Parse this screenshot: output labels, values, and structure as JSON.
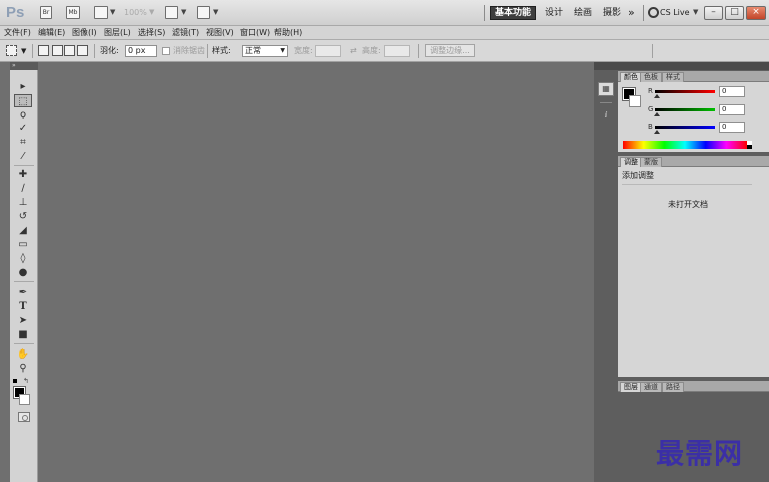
{
  "appbar": {
    "logo": "Ps",
    "zoom": "100%",
    "workspaces": [
      "基本功能",
      "设计",
      "绘画",
      "摄影"
    ],
    "more": "»",
    "cslive": "CS Live",
    "win_min": "–",
    "win_max": "□",
    "win_close": "×",
    "icons": [
      "bridge-icon",
      "minibridge-icon",
      "screen-mode-icon",
      "arrange-icon",
      "extras-icon"
    ]
  },
  "menu": [
    "文件(F)",
    "编辑(E)",
    "图像(I)",
    "图层(L)",
    "选择(S)",
    "滤镜(T)",
    "视图(V)",
    "窗口(W)",
    "帮助(H)"
  ],
  "options": {
    "feather_label": "羽化:",
    "feather_value": "0 px",
    "antialias_label": "消除锯齿",
    "style_label": "样式:",
    "style_value": "正常",
    "width_label": "宽度:",
    "height_label": "高度:",
    "refine_label": "调整边缘..."
  },
  "tools": [
    "move",
    "marquee",
    "lasso",
    "quick-select",
    "crop",
    "eyedropper",
    "healing",
    "brush",
    "stamp",
    "history-brush",
    "eraser",
    "gradient",
    "blur",
    "dodge",
    "pen",
    "type",
    "path-select",
    "shape",
    "hand",
    "zoom"
  ],
  "color_panel": {
    "tabs": [
      "颜色",
      "色板",
      "样式"
    ],
    "r_label": "R",
    "r_value": "0",
    "g_label": "G",
    "g_value": "0",
    "b_label": "B",
    "b_value": "0"
  },
  "adjust_panel": {
    "tabs": [
      "调整",
      "蒙版"
    ],
    "title": "添加调整",
    "empty_message": "未打开文档"
  },
  "layers_panel": {
    "tabs": [
      "图层",
      "通道",
      "路径"
    ]
  },
  "watermark": "最需网",
  "colors": {
    "canvas_bg": "#6f6f6f",
    "panel_bg": "#d6d6d6",
    "workspace_active": "#3f3f3f",
    "close_btn": "#c2452a"
  }
}
